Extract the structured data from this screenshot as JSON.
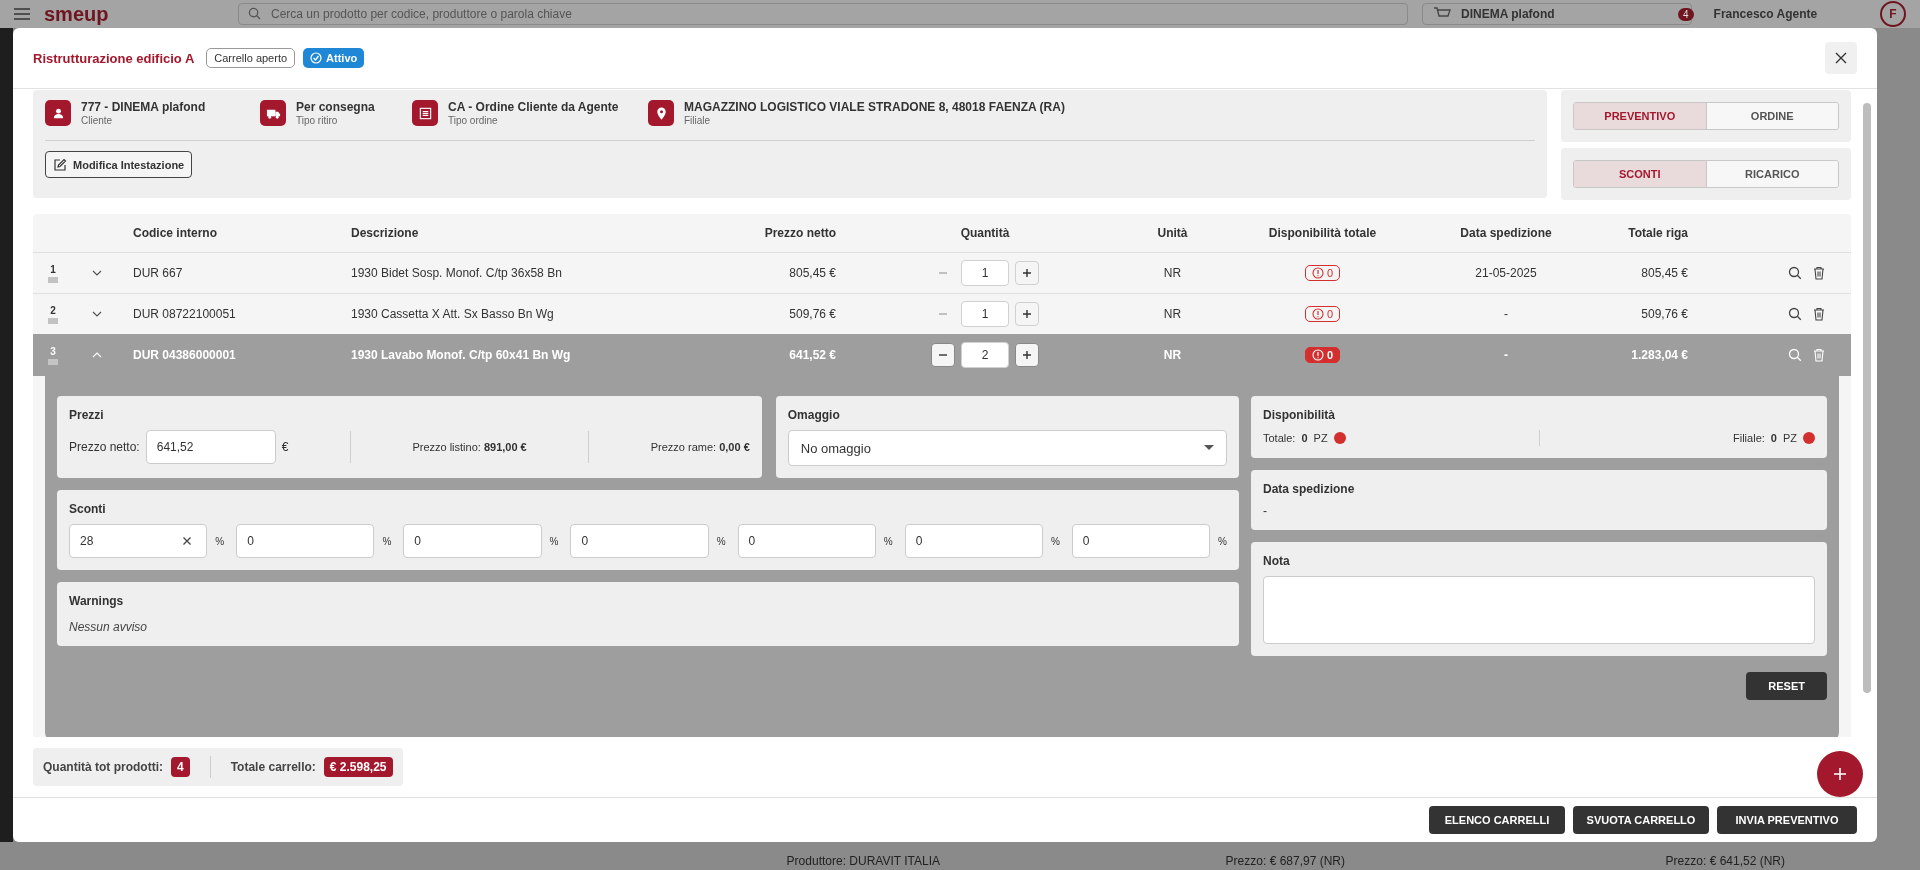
{
  "app_bar": {
    "logo": "smeup",
    "search": {
      "placeholder": "Cerca un prodotto per codice, produttore o parola chiave"
    },
    "cart": {
      "customer": "DINEMA plafond",
      "count": "4"
    },
    "user": {
      "name": "Francesco Agente",
      "initial": "F"
    }
  },
  "background_products": [
    "Produttore: DURAVIT ITALIA",
    "Prezzo: € 687,97 (NR)",
    "Prezzo: € 641,52 (NR)"
  ],
  "dialog": {
    "title": "Ristrutturazione edificio A",
    "tags": [
      {
        "label": "Carrello aperto",
        "kind": "outline"
      },
      {
        "label": "Attivo",
        "kind": "active"
      }
    ],
    "header_fields": [
      {
        "kind": "customer",
        "value": "777 - DINEMA plafond",
        "label": "Cliente"
      },
      {
        "kind": "delivery",
        "value": "Per consegna",
        "label": "Tipo ritiro"
      },
      {
        "kind": "order-type",
        "value": "CA - Ordine Cliente da Agente",
        "label": "Tipo ordine"
      },
      {
        "kind": "branch",
        "value": "MAGAZZINO LOGISTICO VIALE STRADONE 8, 48018 FAENZA (RA)",
        "label": "Filiale"
      }
    ],
    "edit_button": "Modifica Intestazione",
    "document_type": [
      {
        "label": "PREVENTIVO",
        "selected": true
      },
      {
        "label": "ORDINE",
        "selected": false
      }
    ],
    "price_mode": [
      {
        "label": "SCONTI",
        "selected": true
      },
      {
        "label": "RICARICO",
        "selected": false
      }
    ],
    "table": {
      "columns": [
        "Codice interno",
        "Descrizione",
        "Prezzo netto",
        "Quantità",
        "Unità",
        "Disponibilità totale",
        "Data spedizione",
        "Totale riga"
      ],
      "rows": [
        {
          "index": "1",
          "expanded": false,
          "code": "DUR 667",
          "description": "1930 Bidet Sosp. Monof. C/tp 36x58 Bn",
          "net_price": "805,45 €",
          "quantity": "1",
          "decrease_disabled": true,
          "unit": "NR",
          "availability": "0",
          "ship_date": "21-05-2025",
          "total": "805,45 €"
        },
        {
          "index": "2",
          "expanded": false,
          "code": "DUR 08722100051",
          "description": "1930 Cassetta X Att. Sx Basso Bn Wg",
          "net_price": "509,76 €",
          "quantity": "1",
          "decrease_disabled": true,
          "unit": "NR",
          "availability": "0",
          "ship_date": "-",
          "total": "509,76 €"
        },
        {
          "index": "3",
          "expanded": true,
          "code": "DUR 04386000001",
          "description": "1930 Lavabo Monof. C/tp 60x41 Bn Wg",
          "net_price": "641,52 €",
          "quantity": "2",
          "decrease_disabled": false,
          "unit": "NR",
          "availability": "0",
          "ship_date": "-",
          "total": "1.283,04 €"
        }
      ]
    },
    "detail": {
      "prices": {
        "title": "Prezzi",
        "net_label": "Prezzo netto:",
        "net_value": "641,52",
        "currency": "€",
        "list_price": "Prezzo listino: **891,00 €**",
        "copper_price": "Prezzo rame: **0,00 €**"
      },
      "gift": {
        "title": "Omaggio",
        "value": "No omaggio"
      },
      "discounts": {
        "title": "Sconti",
        "fields": [
          {
            "value": "28",
            "clearable": true,
            "unit": "%"
          },
          {
            "value": "0",
            "clearable": false,
            "unit": "%"
          },
          {
            "value": "0",
            "clearable": false,
            "unit": "%"
          },
          {
            "value": "0",
            "clearable": false,
            "unit": "%"
          },
          {
            "value": "0",
            "clearable": false,
            "unit": "%"
          },
          {
            "value": "0",
            "clearable": false,
            "unit": "%"
          },
          {
            "value": "0",
            "clearable": false,
            "unit": "%"
          }
        ]
      },
      "warnings": {
        "title": "Warnings",
        "text": "Nessun avviso"
      },
      "availability": {
        "title": "Disponibilità",
        "items": [
          {
            "label": "Totale:",
            "value": "0",
            "unit": "PZ",
            "color": "#d32f2f"
          },
          {
            "label": "Filiale:",
            "value": "0",
            "unit": "PZ",
            "color": "#d32f2f"
          }
        ]
      },
      "ship_date": {
        "title": "Data spedizione",
        "value": "-"
      },
      "note": {
        "title": "Nota"
      },
      "reset_button": "RESET"
    },
    "totals": {
      "quantity_label": "Quantità tot prodotti:",
      "quantity": "4",
      "total_label": "Totale carrello:",
      "total": "€ 2.598,25"
    },
    "buttons": [
      "ELENCO CARRELLI",
      "SVUOTA CARRELLO",
      "INVIA PREVENTIVO"
    ]
  }
}
